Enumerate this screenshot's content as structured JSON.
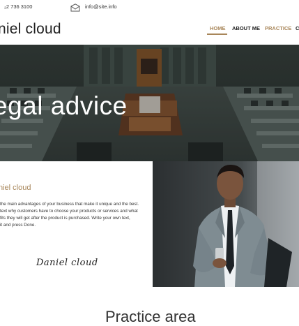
{
  "topbar": {
    "phone": "₂2 736 3100",
    "email": "info@site.info",
    "mail_icon": "envelope-icon"
  },
  "header": {
    "brand": "niel cloud",
    "nav": [
      {
        "label": "HOME",
        "active": true
      },
      {
        "label": "ABOUT ME",
        "active": false
      },
      {
        "label": "PRACTICE",
        "active": false
      },
      {
        "label": "C",
        "active": false
      }
    ]
  },
  "hero": {
    "title": "egal advice"
  },
  "about": {
    "title": "niel cloud",
    "paragraph_lines": [
      "the main advantages of your business that make it unique and the best.",
      "text why customers have to choose your products or services and what",
      "fits they will get after the product is purchased. Write your own text,",
      "it and press Done."
    ],
    "signature": "Daniel cloud"
  },
  "practice": {
    "heading": "Practice area"
  },
  "colors": {
    "accent": "#a8865a",
    "text": "#222222",
    "hero_overlay": "#1f2526"
  }
}
